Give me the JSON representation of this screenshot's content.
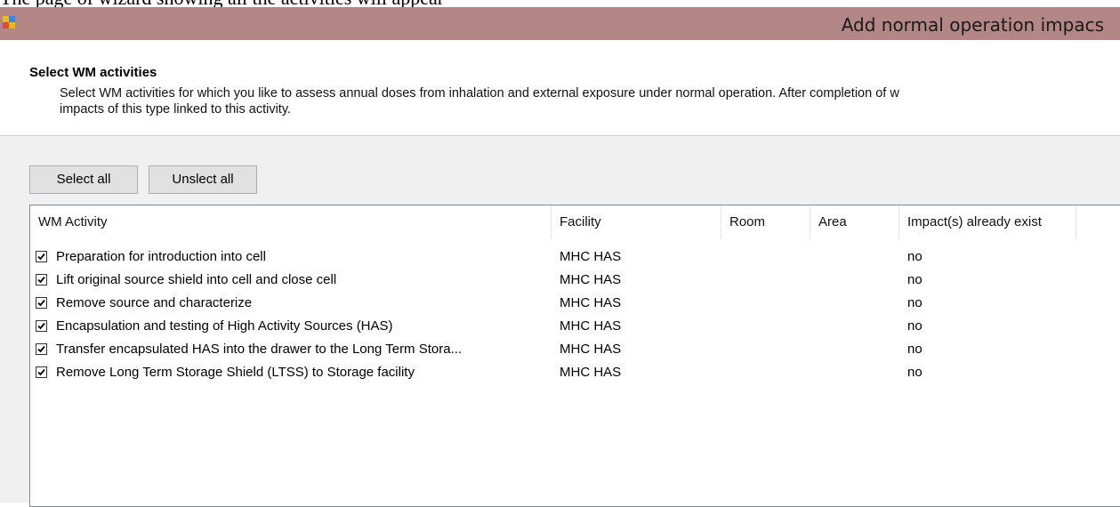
{
  "caption": "The page of wizard showing all the activities will appear",
  "window": {
    "title": "Add normal operation impacs",
    "icon": "app-icon"
  },
  "header": {
    "title": "Select WM activities",
    "description_line1": "Select WM activities for which you like to assess annual doses from inhalation and external exposure under normal operation. After completion of w",
    "description_line2": "impacts  of this type linked to this activity."
  },
  "buttons": {
    "select_all": "Select all",
    "unselect_all": "Unslect all"
  },
  "table": {
    "columns": [
      "WM Activity",
      "Facility",
      "Room",
      "Area",
      "Impact(s) already exist"
    ],
    "rows": [
      {
        "checked": true,
        "activity": "Preparation for  introduction into cell",
        "facility": "MHC HAS",
        "room": "",
        "area": "",
        "impact": "no"
      },
      {
        "checked": true,
        "activity": "Lift original source shield into cell and close cell",
        "facility": "MHC HAS",
        "room": "",
        "area": "",
        "impact": "no"
      },
      {
        "checked": true,
        "activity": "Remove source and characterize",
        "facility": "MHC HAS",
        "room": "",
        "area": "",
        "impact": "no"
      },
      {
        "checked": true,
        "activity": "Encapsulation and testing of High Activity Sources (HAS)",
        "facility": "MHC HAS",
        "room": "",
        "area": "",
        "impact": "no"
      },
      {
        "checked": true,
        "activity": "Transfer encapsulated HAS into the drawer to the Long Term Stora...",
        "facility": "MHC HAS",
        "room": "",
        "area": "",
        "impact": "no"
      },
      {
        "checked": true,
        "activity": "Remove Long Term Storage Shield (LTSS) to Storage facility",
        "facility": "MHC HAS",
        "room": "",
        "area": "",
        "impact": "no"
      }
    ]
  },
  "colors": {
    "titlebar": "#b38786",
    "panel": "#f0f0f0"
  }
}
